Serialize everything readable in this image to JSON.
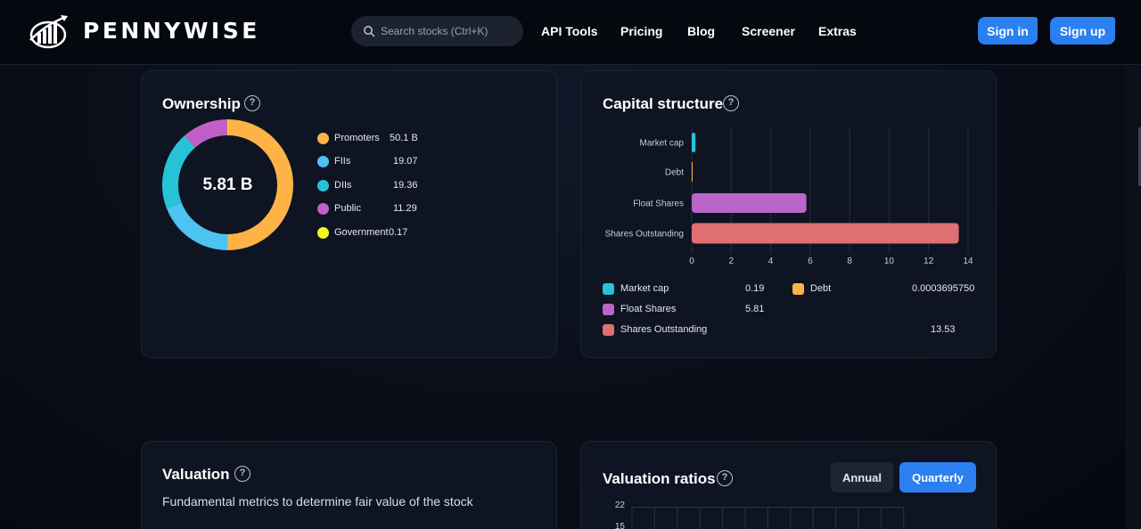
{
  "brand": {
    "name": "PENNYWISE",
    "logo_icon": "chart-growth-logo-icon"
  },
  "search": {
    "placeholder": "Search stocks (Ctrl+K)",
    "icon": "search-icon"
  },
  "nav": {
    "links": [
      "API Tools",
      "Pricing",
      "Blog",
      "Screener",
      "Extras"
    ],
    "sign_in": "Sign in",
    "sign_up": "Sign up"
  },
  "colors": {
    "accent": "#2b7ff0",
    "promoters": "#ffb347",
    "fiis": "#4cc3f0",
    "diis": "#26c3d6",
    "public": "#c05fc8",
    "government": "#f7f71d",
    "debt": "#ffb347",
    "float": "#b966c8",
    "shares_outstanding": "#e06f72"
  },
  "ownership": {
    "title": "Ownership",
    "center_value": "5.81 B",
    "legend": [
      {
        "label": "Promoters",
        "value": "50.1 B",
        "share": 50.1,
        "color": "#ffb347"
      },
      {
        "label": "FIIs",
        "value": "19.07",
        "share": 19.07,
        "color": "#4cc3f0"
      },
      {
        "label": "DIIs",
        "value": "19.36",
        "share": 19.36,
        "color": "#26c3d6"
      },
      {
        "label": "Public",
        "value": "11.29",
        "share": 11.29,
        "color": "#c05fc8"
      },
      {
        "label": "Government",
        "value": "0.17",
        "share": 0.17,
        "color": "#f7f71d"
      }
    ]
  },
  "capital_structure": {
    "title": "Capital structure",
    "legend": [
      {
        "label": "Market cap",
        "value": "0.19",
        "color": "#26c3d6"
      },
      {
        "label": "Debt",
        "value": "0.0003695750",
        "color": "#ffb347"
      },
      {
        "label": "Float Shares",
        "value": "5.81",
        "color": "#b966c8"
      },
      {
        "label": "Shares Outstanding",
        "value": "13.53",
        "color": "#e06f72"
      }
    ]
  },
  "chart_data": {
    "type": "bar",
    "orientation": "horizontal",
    "categories": [
      "Market cap",
      "Debt",
      "Float Shares",
      "Shares Outstanding"
    ],
    "values": [
      0.19,
      0.000369575,
      5.81,
      13.53
    ],
    "colors": [
      "#26c3d6",
      "#ffb347",
      "#b966c8",
      "#e06f72"
    ],
    "xlim": [
      0,
      14
    ],
    "xticks": [
      "0",
      "2",
      "4",
      "6",
      "8",
      "10",
      "12",
      "14"
    ],
    "grid": "vertical"
  },
  "valuation": {
    "title": "Valuation",
    "subtitle": "Fundamental metrics to determine fair value of the stock"
  },
  "valuation_ratios": {
    "title": "Valuation ratios",
    "annual_label": "Annual",
    "quarterly_label": "Quarterly",
    "y_ticks": [
      "22",
      "15"
    ]
  }
}
